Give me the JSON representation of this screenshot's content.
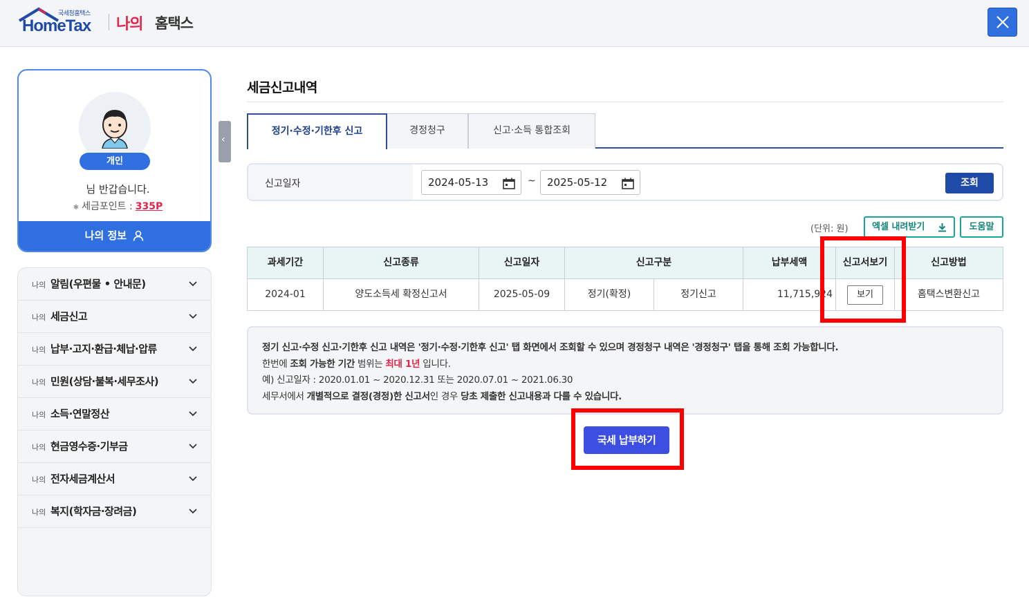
{
  "header": {
    "logo_small": "국세청홈택스",
    "logo_main": "HomeTax",
    "my_label": "나의",
    "hometax_label": "홈택스"
  },
  "profile": {
    "type_badge": "개인",
    "greeting": "님 반갑습니다.",
    "points_label": "세금포인트 :",
    "points_value": "335P",
    "myinfo_label": "나의 정보"
  },
  "sidebar": {
    "prefix": "나의",
    "items": [
      {
        "label": "알림(우편물 • 안내문)"
      },
      {
        "label": "세금신고"
      },
      {
        "label": "납부·고지·환급·체납·압류"
      },
      {
        "label": "민원(상담·불복·세무조사)"
      },
      {
        "label": "소득·연말정산"
      },
      {
        "label": "현금영수증·기부금"
      },
      {
        "label": "전자세금계산서"
      },
      {
        "label": "복지(학자금·장려금)"
      }
    ]
  },
  "main": {
    "title": "세금신고내역",
    "tabs": [
      {
        "label": "정기·수정·기한후 신고",
        "active": true
      },
      {
        "label": "경정청구",
        "active": false
      },
      {
        "label": "신고·소득 통합조회",
        "active": false
      }
    ],
    "search": {
      "label": "신고일자",
      "date_from": "2024-05-13",
      "tilde": "~",
      "date_to": "2025-05-12",
      "button": "조회"
    },
    "unit": "(단위: 원)",
    "excel_button": "엑셀 내려받기",
    "help_button": "도움말",
    "table": {
      "headers": [
        "과세기간",
        "신고종류",
        "신고일자",
        "신고구분",
        "납부세액",
        "신고서보기",
        "신고방법"
      ],
      "row": {
        "period": "2024-01",
        "type": "양도소득세 확정신고서",
        "date": "2025-05-09",
        "category_a": "정기(확정)",
        "category_b": "정기신고",
        "amount": "11,715,924",
        "view": "보기",
        "method": "홈택스변환신고"
      }
    },
    "notice": {
      "line1_a": "정기 신고·수정 신고·기한후 신고 내역은 '정기·수정·기한후 신고' 탭 화면에서 조회할 수 있으며 경정청구 내역은",
      "line1_b": "'경정청구' 탭을 통해 조회 가능합니다.",
      "line2_a": "한번에",
      "line2_b": "조회 가능한 기간",
      "line2_c": "범위는",
      "line2_red": "최대 1년",
      "line2_d": "입니다.",
      "line3": "예) 신고일자 : 2020.01.01 ~ 2020.12.31 또는 2020.07.01 ~ 2021.06.30",
      "line4_a": "세무서에서",
      "line4_b": "개별적으로 결정(경정)한 신고서",
      "line4_c": "인 경우",
      "line4_d": "당초 제출한 신고내용과 다를 수 있습니다."
    },
    "pay_button": "국세 납부하기"
  },
  "colors": {
    "primary": "#2f6fe0",
    "tab_active": "#2d4f9e",
    "teal": "#1aa59a",
    "pay": "#3d4fe0",
    "highlight": "#ff0000"
  }
}
